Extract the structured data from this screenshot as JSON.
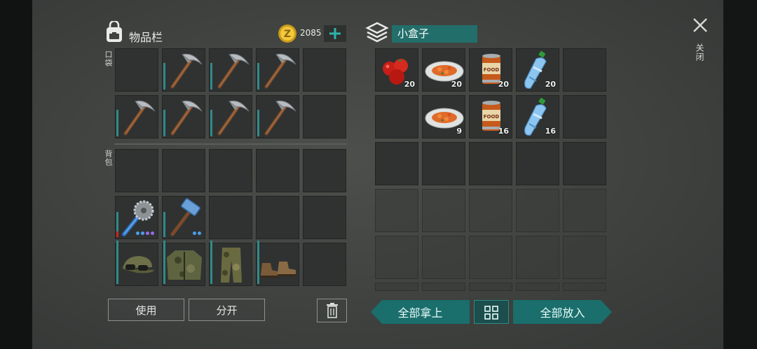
{
  "inventory": {
    "title": "物品栏",
    "coins": "2085",
    "pocket_label": "口袋",
    "backpack_label": "背包",
    "pocket_slots": [
      {
        "item": "",
        "count": ""
      },
      {
        "item": "pickaxe",
        "count": ""
      },
      {
        "item": "pickaxe",
        "count": ""
      },
      {
        "item": "pickaxe",
        "count": ""
      },
      {
        "item": "",
        "count": ""
      },
      {
        "item": "pickaxe",
        "count": ""
      },
      {
        "item": "pickaxe",
        "count": ""
      },
      {
        "item": "pickaxe",
        "count": ""
      },
      {
        "item": "pickaxe",
        "count": ""
      },
      {
        "item": "",
        "count": ""
      }
    ],
    "backpack_slots": [
      {
        "item": "",
        "count": ""
      },
      {
        "item": "",
        "count": ""
      },
      {
        "item": "",
        "count": ""
      },
      {
        "item": "",
        "count": ""
      },
      {
        "item": "",
        "count": ""
      },
      {
        "item": "saw-mace",
        "count": ""
      },
      {
        "item": "sledgehammer",
        "count": ""
      },
      {
        "item": "",
        "count": ""
      },
      {
        "item": "",
        "count": ""
      },
      {
        "item": "",
        "count": ""
      },
      {
        "item": "cap-goggles",
        "count": ""
      },
      {
        "item": "camo-jacket",
        "count": ""
      },
      {
        "item": "camo-pants",
        "count": ""
      },
      {
        "item": "boots",
        "count": ""
      },
      {
        "item": "",
        "count": ""
      }
    ],
    "buttons": {
      "use": "使用",
      "split": "分开"
    }
  },
  "container": {
    "name": "小盒子",
    "slots": [
      {
        "item": "tomatoes",
        "count": "20"
      },
      {
        "item": "carrot-plate",
        "count": "20"
      },
      {
        "item": "canned-food",
        "count": "20"
      },
      {
        "item": "water-bottle",
        "count": "20"
      },
      {
        "item": "",
        "count": ""
      },
      {
        "item": "",
        "count": ""
      },
      {
        "item": "carrot-plate",
        "count": "9"
      },
      {
        "item": "canned-food",
        "count": "16"
      },
      {
        "item": "water-bottle",
        "count": "16"
      },
      {
        "item": "",
        "count": ""
      }
    ],
    "buttons": {
      "take_all": "全部拿上",
      "put_all": "全部放入"
    }
  },
  "close_label": "关闭",
  "colors": {
    "accent": "#1a6e6c",
    "durability": "#2f8a8a",
    "coin": "#e3b62a"
  }
}
